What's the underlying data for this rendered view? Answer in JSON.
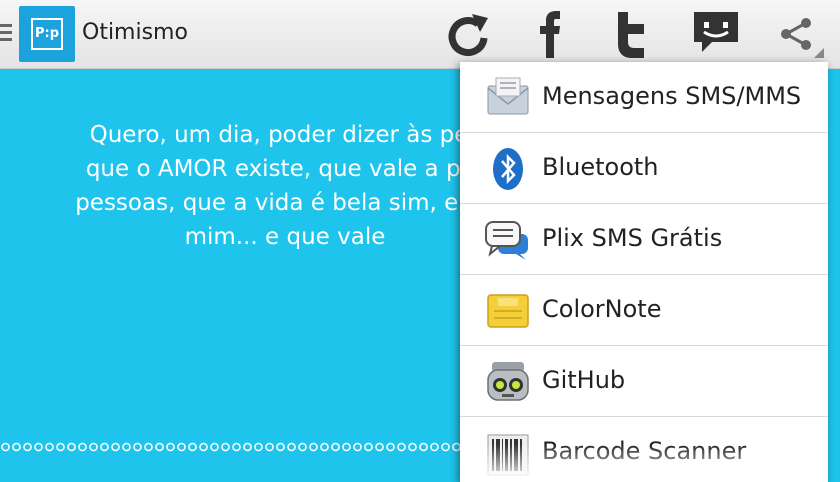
{
  "app": {
    "title": "Otimismo",
    "icon_text": "P:p"
  },
  "toolbar": {
    "refresh_icon": "refresh-icon",
    "facebook_icon": "facebook-icon",
    "twitter_icon": "twitter-icon",
    "comment_icon": "comment-icon",
    "share_icon": "share-icon"
  },
  "quote": {
    "lines": [
      "Quero, um dia, poder dizer às pes",
      "que o AMOR existe, que vale a per",
      "pessoas, que a vida é bela sim, e qu",
      "mim... e que vale"
    ]
  },
  "share_menu": {
    "items": [
      {
        "label": "Mensagens SMS/MMS",
        "icon": "envelope-icon"
      },
      {
        "label": "Bluetooth",
        "icon": "bluetooth-icon"
      },
      {
        "label": "Plix SMS Grátis",
        "icon": "chat-bubbles-icon"
      },
      {
        "label": "ColorNote",
        "icon": "note-icon"
      },
      {
        "label": "GitHub",
        "icon": "github-robot-icon"
      },
      {
        "label": "Barcode Scanner",
        "icon": "barcode-icon"
      }
    ]
  },
  "colors": {
    "background": "#1ec4ec",
    "actionbar": "#eeeeee",
    "accent": "#1aa3dc"
  }
}
